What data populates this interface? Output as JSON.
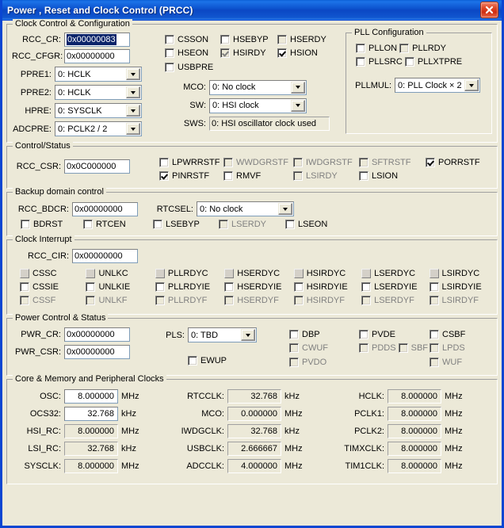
{
  "window": {
    "title": "Power , Reset and Clock Control (PRCC)",
    "close_icon": "close-icon",
    "titlebar_color": "#0b47c4",
    "face_color": "#ece9d8",
    "selection_color": "#0a246a"
  },
  "clock_control": {
    "legend": "Clock Control & Configuration",
    "fields": [
      {
        "label": "RCC_CR:",
        "value": "0x00000083",
        "selected": true
      },
      {
        "label": "RCC_CFGR:",
        "value": "0x00000000",
        "selected": false
      }
    ],
    "combos": [
      {
        "label": "PPRE1:",
        "value": "0: HCLK"
      },
      {
        "label": "PPRE2:",
        "value": "0: HCLK"
      },
      {
        "label": "HPRE:",
        "value": "0: SYSCLK"
      },
      {
        "label": "ADCPRE:",
        "value": "0: PCLK2 / 2"
      }
    ],
    "right_combos": [
      {
        "label": "MCO:",
        "value": "0: No clock",
        "readonly": false
      },
      {
        "label": "SW:",
        "value": "0: HSI clock",
        "readonly": false
      },
      {
        "label": "SWS:",
        "value": "0: HSI oscillator clock used",
        "readonly": true
      }
    ],
    "checks_col1": [
      {
        "label": "CSSON",
        "checked": false,
        "disabled": false
      },
      {
        "label": "HSEON",
        "checked": false,
        "disabled": false
      },
      {
        "label": "USBPRE",
        "checked": false,
        "disabled": false
      }
    ],
    "checks_col2": [
      {
        "label": "HSEBYP",
        "checked": false,
        "disabled": false
      },
      {
        "label": "HSIRDY",
        "checked": true,
        "disabled": true
      }
    ],
    "checks_col3": [
      {
        "label": "HSERDY",
        "checked": false,
        "disabled": true
      },
      {
        "label": "HSION",
        "checked": true,
        "disabled": false
      }
    ],
    "pll": {
      "legend": "PLL Configuration",
      "checks": [
        {
          "label": "PLLON",
          "checked": false,
          "disabled": false
        },
        {
          "label": "PLLRDY",
          "checked": false,
          "disabled": true
        },
        {
          "label": "PLLSRC",
          "checked": false,
          "disabled": false
        },
        {
          "label": "PLLXTPRE",
          "checked": false,
          "disabled": false
        }
      ],
      "mul_label": "PLLMUL:",
      "mul_value": "0: PLL Clock × 2"
    }
  },
  "control_status": {
    "legend": "Control/Status",
    "field": {
      "label": "RCC_CSR:",
      "value": "0x0C000000"
    },
    "columns": [
      [
        {
          "label": "LPWRRSTF",
          "checked": false,
          "disabled": false
        },
        {
          "label": "PINRSTF",
          "checked": true,
          "disabled": false
        }
      ],
      [
        {
          "label": "WWDGRSTF",
          "checked": false,
          "disabled": true
        },
        {
          "label": "RMVF",
          "checked": false,
          "disabled": false
        }
      ],
      [
        {
          "label": "IWDGRSTF",
          "checked": false,
          "disabled": true
        },
        {
          "label": "LSIRDY",
          "checked": false,
          "disabled": true
        }
      ],
      [
        {
          "label": "SFTRSTF",
          "checked": false,
          "disabled": true
        },
        {
          "label": "LSION",
          "checked": false,
          "disabled": false
        }
      ],
      [
        {
          "label": "PORRSTF",
          "checked": true,
          "disabled": false
        }
      ]
    ]
  },
  "backup_domain": {
    "legend": "Backup domain control",
    "field": {
      "label": "RCC_BDCR:",
      "value": "0x00000000"
    },
    "combo": {
      "label": "RTCSEL:",
      "value": "0: No clock"
    },
    "checks": [
      {
        "label": "BDRST",
        "checked": false,
        "disabled": false
      },
      {
        "label": "RTCEN",
        "checked": false,
        "disabled": false
      },
      {
        "label": "LSEBYP",
        "checked": false,
        "disabled": false
      },
      {
        "label": "LSERDY",
        "checked": false,
        "disabled": true
      },
      {
        "label": "LSEON",
        "checked": false,
        "disabled": false
      }
    ]
  },
  "clock_interrupt": {
    "legend": "Clock Interrupt",
    "field": {
      "label": "RCC_CIR:",
      "value": "0x00000000"
    },
    "columns": [
      [
        {
          "label": "CSSC",
          "style": "flat"
        },
        {
          "label": "CSSIE",
          "style": "normal"
        },
        {
          "label": "CSSF",
          "style": "disabled"
        }
      ],
      [
        {
          "label": "UNLKC",
          "style": "flat"
        },
        {
          "label": "UNLKIE",
          "style": "normal"
        },
        {
          "label": "UNLKF",
          "style": "disabled"
        }
      ],
      [
        {
          "label": "PLLRDYC",
          "style": "flat"
        },
        {
          "label": "PLLRDYIE",
          "style": "normal"
        },
        {
          "label": "PLLRDYF",
          "style": "disabled"
        }
      ],
      [
        {
          "label": "HSERDYC",
          "style": "flat"
        },
        {
          "label": "HSERDYIE",
          "style": "normal"
        },
        {
          "label": "HSERDYF",
          "style": "disabled"
        }
      ],
      [
        {
          "label": "HSIRDYC",
          "style": "flat"
        },
        {
          "label": "HSIRDYIE",
          "style": "normal"
        },
        {
          "label": "HSIRDYF",
          "style": "disabled"
        }
      ],
      [
        {
          "label": "LSERDYC",
          "style": "flat"
        },
        {
          "label": "LSERDYIE",
          "style": "normal"
        },
        {
          "label": "LSERDYF",
          "style": "disabled"
        }
      ],
      [
        {
          "label": "LSIRDYC",
          "style": "flat"
        },
        {
          "label": "LSIRDYIE",
          "style": "normal"
        },
        {
          "label": "LSIRDYF",
          "style": "disabled"
        }
      ]
    ]
  },
  "power_control": {
    "legend": "Power Control & Status",
    "fields": [
      {
        "label": "PWR_CR:",
        "value": "0x00000000"
      },
      {
        "label": "PWR_CSR:",
        "value": "0x00000000"
      }
    ],
    "combo": {
      "label": "PLS:",
      "value": "0: TBD"
    },
    "ewup": {
      "label": "EWUP",
      "checked": false,
      "disabled": false
    },
    "columns": [
      [
        {
          "label": "DBP",
          "checked": false,
          "disabled": false
        },
        {
          "label": "CWUF",
          "checked": false,
          "disabled": true
        },
        {
          "label": "PVDO",
          "checked": false,
          "disabled": true
        }
      ],
      [
        {
          "label": "PVDE",
          "checked": false,
          "disabled": false
        },
        {
          "label": "PDDS",
          "checked": false,
          "disabled": true
        },
        {
          "label": "SBF",
          "checked": false,
          "disabled": true
        }
      ],
      [
        {
          "label": "CSBF",
          "checked": false,
          "disabled": false
        },
        {
          "label": "LPDS",
          "checked": false,
          "disabled": true
        },
        {
          "label": "WUF",
          "checked": false,
          "disabled": true
        }
      ]
    ]
  },
  "clocks": {
    "legend": "Core & Memory and Peripheral Clocks",
    "col1": [
      {
        "label": "OSC:",
        "value": "8.000000",
        "unit": "MHz",
        "readonly": false
      },
      {
        "label": "OCS32:",
        "value": "32.768",
        "unit": "kHz",
        "readonly": false
      },
      {
        "label": "HSI_RC:",
        "value": "8.000000",
        "unit": "MHz",
        "readonly": true
      },
      {
        "label": "LSI_RC:",
        "value": "32.768",
        "unit": "kHz",
        "readonly": true
      },
      {
        "label": "SYSCLK:",
        "value": "8.000000",
        "unit": "MHz",
        "readonly": true
      }
    ],
    "col2": [
      {
        "label": "RTCCLK:",
        "value": "32.768",
        "unit": "kHz",
        "readonly": true
      },
      {
        "label": "MCO:",
        "value": "0.000000",
        "unit": "MHz",
        "readonly": true
      },
      {
        "label": "IWDGCLK:",
        "value": "32.768",
        "unit": "kHz",
        "readonly": true
      },
      {
        "label": "USBCLK:",
        "value": "2.666667",
        "unit": "MHz",
        "readonly": true
      },
      {
        "label": "ADCCLK:",
        "value": "4.000000",
        "unit": "MHz",
        "readonly": true
      }
    ],
    "col3": [
      {
        "label": "HCLK:",
        "value": "8.000000",
        "unit": "MHz",
        "readonly": true
      },
      {
        "label": "PCLK1:",
        "value": "8.000000",
        "unit": "MHz",
        "readonly": true
      },
      {
        "label": "PCLK2:",
        "value": "8.000000",
        "unit": "MHz",
        "readonly": true
      },
      {
        "label": "TIMXCLK:",
        "value": "8.000000",
        "unit": "MHz",
        "readonly": true
      },
      {
        "label": "TIM1CLK:",
        "value": "8.000000",
        "unit": "MHz",
        "readonly": true
      }
    ]
  }
}
